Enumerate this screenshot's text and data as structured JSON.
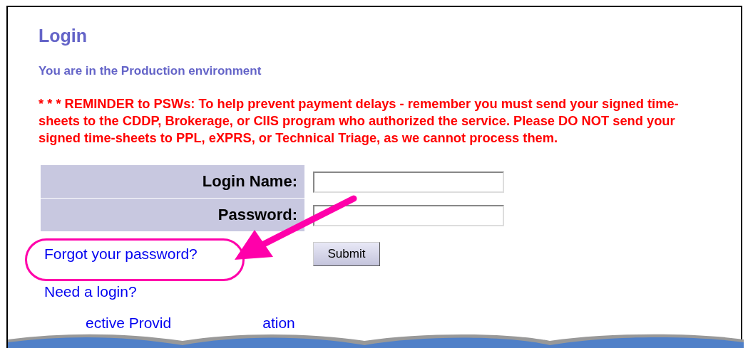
{
  "heading": "Login",
  "environment_notice": "You are in the Production environment",
  "reminder": "* * * REMINDER to PSWs: To help prevent payment delays - remember you must send your signed time-sheets to the CDDP, Brokerage, or CIIS program who authorized the service. Please DO NOT send your signed time-sheets to PPL, eXPRS, or Technical Triage, as we cannot process them.",
  "form": {
    "fields": [
      {
        "label": "Login Name:"
      },
      {
        "label": "Password:"
      }
    ],
    "submit": "Submit"
  },
  "links": [
    {
      "text": "Forgot your password?",
      "highlighted": true
    },
    {
      "text": "Need a login?",
      "highlighted": false
    }
  ],
  "partial_link": [
    "ective Provid",
    "ation"
  ]
}
